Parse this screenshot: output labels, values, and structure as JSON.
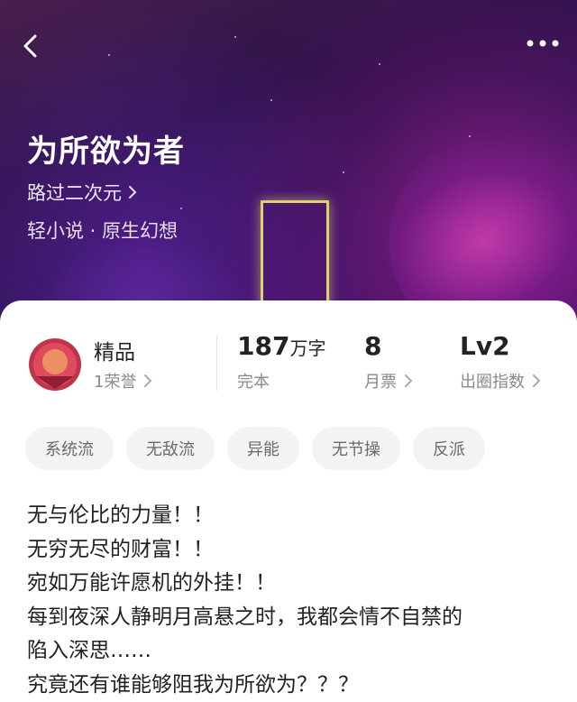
{
  "book": {
    "title": "为所欲为者",
    "author": "路过二次元",
    "genre": "轻小说 · 原生幻想"
  },
  "stats": {
    "quality": {
      "label": "精品",
      "honor": "1荣誉"
    },
    "words": {
      "value": "187",
      "unit": "万字",
      "status": "完本"
    },
    "monthly_ticket": {
      "value": "8",
      "label": "月票"
    },
    "circle_index": {
      "value": "Lv2",
      "label": "出圈指数"
    }
  },
  "tags": [
    "系统流",
    "无敌流",
    "异能",
    "无节操",
    "反派"
  ],
  "synopsis": [
    "无与伦比的力量！！",
    "无穷无尽的财富！！",
    "宛如万能许愿机的外挂！！",
    "每到夜深人静明月高悬之时，我都会情不自禁的",
    "陷入深思……",
    "究竟还有谁能够阻我为所欲为？？？"
  ],
  "icons": {
    "back": "chevron-left-icon",
    "more": "more-horizontal-icon",
    "badge": "quality-badge-icon"
  }
}
